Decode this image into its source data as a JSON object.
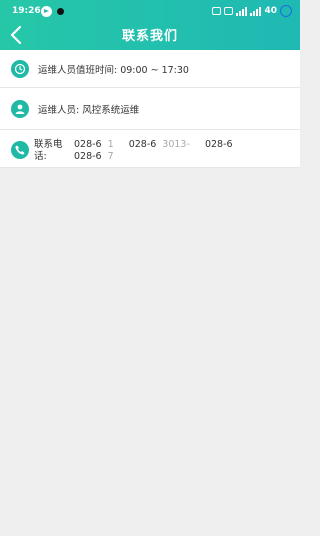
{
  "status_bar": {
    "time": "19:26",
    "battery": "40"
  },
  "header": {
    "title": "联系我们",
    "back_icon": "chevron-left-icon"
  },
  "contact": {
    "duty_time": "运维人员值班时间:  09:00 ~ 17:30",
    "staff": "运维人员:  风控系统运维",
    "phone_label": "联系电话:",
    "phones": [
      "028-6",
      "028-6",
      "028-6",
      "028-6"
    ],
    "phone_fragments": [
      "1",
      "3013-",
      "7"
    ]
  },
  "colors": {
    "accent": "#1fb9a6",
    "header_start": "#26c7a8",
    "header_end": "#1fb9b3",
    "background": "#efefef"
  }
}
